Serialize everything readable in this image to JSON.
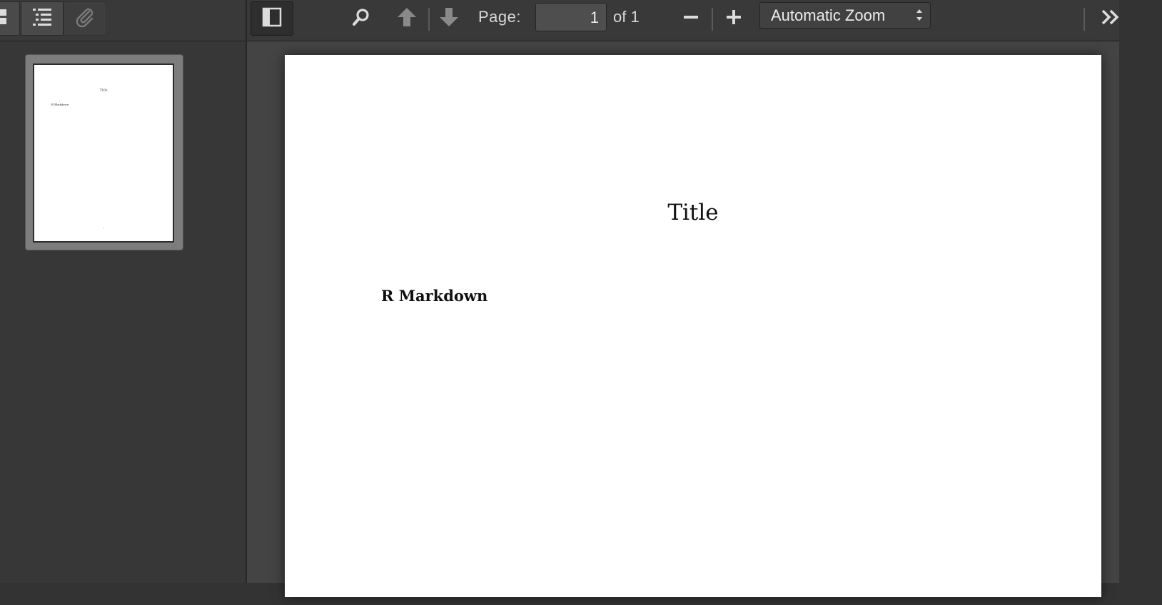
{
  "sidebar": {
    "views": [
      {
        "name": "thumbnails",
        "icon": "thumbnails-icon"
      },
      {
        "name": "outline",
        "icon": "outline-icon"
      },
      {
        "name": "attachments",
        "icon": "paperclip-icon"
      }
    ],
    "thumbnail": {
      "title": "Title",
      "heading": "R Markdown",
      "page_number": "1"
    }
  },
  "toolbar": {
    "page_label": "Page:",
    "current_page": "1",
    "page_count": "of 1",
    "zoom": "Automatic Zoom",
    "zoom_options": [
      "Automatic Zoom"
    ]
  },
  "document": {
    "title": "Title",
    "heading": "R Markdown"
  },
  "colors": {
    "toolbar_bg": "#393939",
    "sidebar_bg": "#373737",
    "viewer_bg": "#444444",
    "page_bg": "#ffffff",
    "icon": "#dcdcdc",
    "icon_disabled": "#8a8a8a"
  }
}
